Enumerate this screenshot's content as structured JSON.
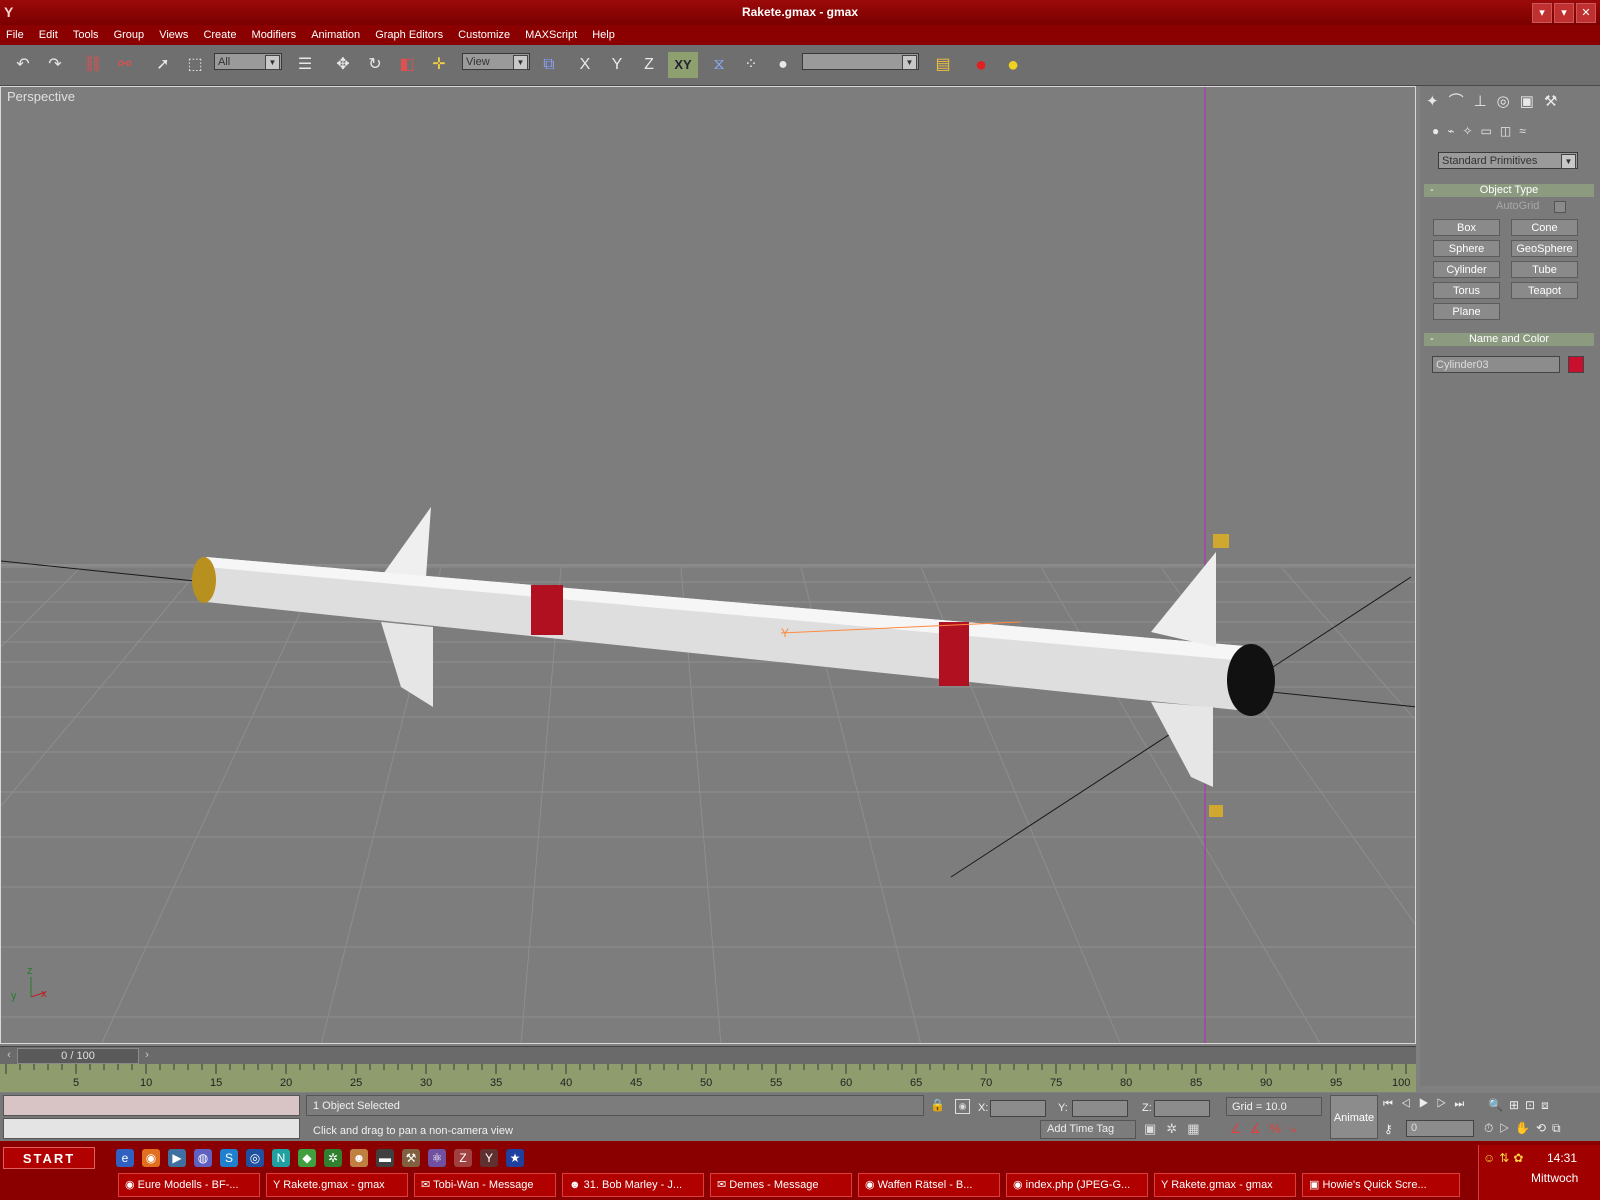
{
  "window": {
    "title": "Rakete.gmax - gmax",
    "controls": [
      "▾",
      "▾",
      "✕"
    ]
  },
  "menu": [
    "File",
    "Edit",
    "Tools",
    "Group",
    "Views",
    "Create",
    "Modifiers",
    "Animation",
    "Graph Editors",
    "Customize",
    "MAXScript",
    "Help"
  ],
  "toolbar": {
    "selection_filter": "All",
    "ref_coord": "View",
    "axis_x": "X",
    "axis_y": "Y",
    "axis_z": "Z",
    "axis_xy": "XY",
    "named_selection": ""
  },
  "viewport": {
    "label": "Perspective",
    "axis_x": "x",
    "axis_y": "y",
    "axis_z": "z"
  },
  "command_panel": {
    "category": "Standard Primitives",
    "object_type": {
      "header": "Object Type",
      "autogrid": "AutoGrid",
      "buttons": [
        "Box",
        "Cone",
        "Sphere",
        "GeoSphere",
        "Cylinder",
        "Tube",
        "Torus",
        "Teapot",
        "Plane"
      ]
    },
    "name_color": {
      "header": "Name and Color",
      "name": "Cylinder03",
      "color": "#c8102e"
    }
  },
  "timeline": {
    "slider_label": "0 / 100",
    "ticks": [
      "5",
      "10",
      "15",
      "20",
      "25",
      "30",
      "35",
      "40",
      "45",
      "50",
      "55",
      "60",
      "65",
      "70",
      "75",
      "80",
      "85",
      "90",
      "95",
      "100"
    ]
  },
  "status": {
    "selection": "1 Object Selected",
    "prompt": "Click and drag to pan a non-camera view",
    "x_label": "X:",
    "y_label": "Y:",
    "z_label": "Z:",
    "grid": "Grid = 10.0",
    "add_time_tag": "Add Time Tag",
    "animate": "Animate",
    "frame": "0"
  },
  "taskbar": {
    "start": "START",
    "tasks": [
      "Eure Modells - BF-...",
      "Rakete.gmax - gmax",
      "Tobi-Wan - Message",
      "31. Bob Marley - J...",
      "Demes - Message",
      "Waffen Rätsel - B...",
      "index.php (JPEG-G...",
      "Rakete.gmax - gmax",
      "Howie's Quick Scre..."
    ],
    "time": "14:31",
    "day": "Mittwoch"
  }
}
